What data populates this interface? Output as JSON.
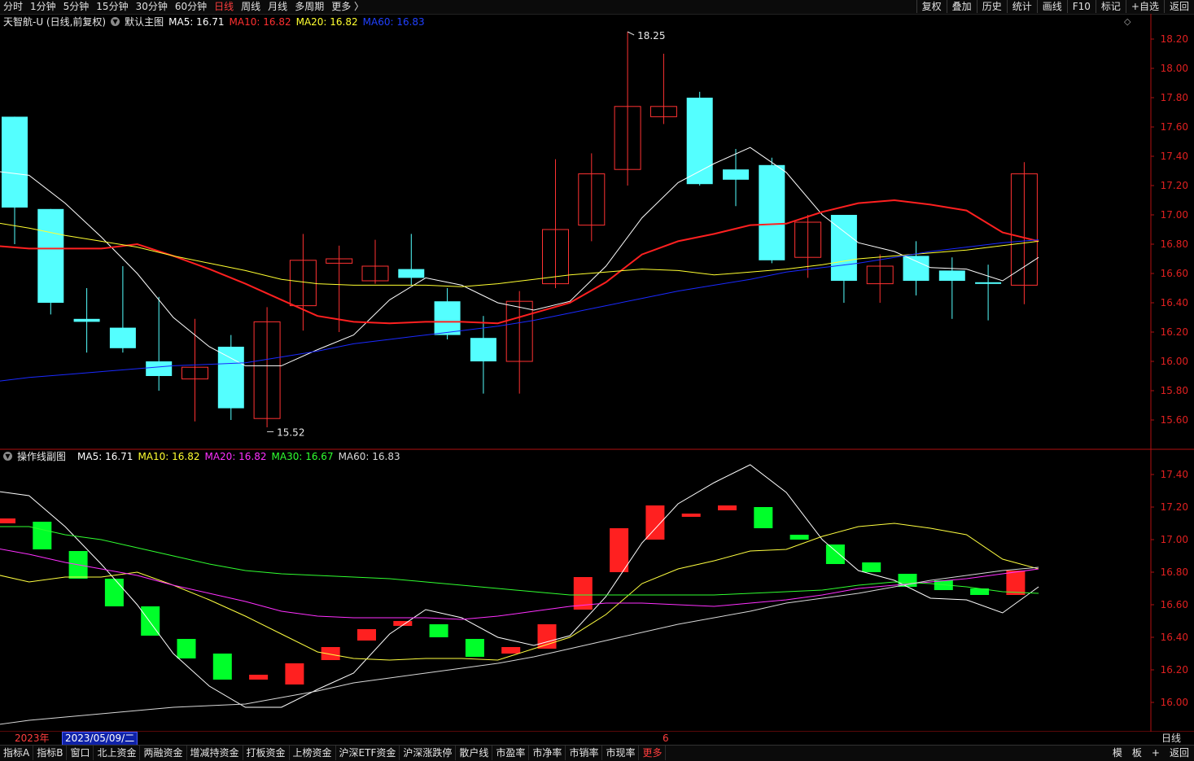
{
  "toolbar": {
    "periods": [
      "分时",
      "1分钟",
      "5分钟",
      "15分钟",
      "30分钟",
      "60分钟",
      "日线",
      "周线",
      "月线",
      "多周期",
      "更多 〉"
    ],
    "active_period": "日线",
    "right_items": [
      "复权",
      "叠加",
      "历史",
      "统计",
      "画线",
      "F10",
      "标记",
      "+自选",
      "返回"
    ]
  },
  "main_legend": {
    "title": "天智航-U (日线,前复权)",
    "template": "默认主图",
    "ma5": "MA5: 16.71",
    "ma10": "MA10: 16.82",
    "ma20": "MA20: 16.82",
    "ma60": "MA60: 16.83"
  },
  "sub_legend": {
    "title": "操作线副图",
    "ma5": "MA5: 16.71",
    "ma10": "MA10: 16.82",
    "ma20": "MA20: 16.82",
    "ma30": "MA30: 16.67",
    "ma60": "MA60: 16.83"
  },
  "colors": {
    "up": "#ff3232",
    "down": "#54ffff",
    "sub_up": "#ff2020",
    "sub_down": "#00ff2a",
    "ma5": "#ffffff",
    "ma10": "#ff2020",
    "ma20": "#ffff30",
    "ma60": "#1a2aff",
    "sub_ma10": "#ffff40",
    "sub_ma20": "#ff30ff",
    "sub_ma30": "#30ff30",
    "sub_ma60": "#d8d8d8"
  },
  "date_bar": {
    "year": "2023年",
    "cursor_date": "2023/05/09/二",
    "month_mark": "6"
  },
  "period_label": "日线",
  "bottom_bar": {
    "tabs": [
      "指标A",
      "指标B",
      "窗口",
      "北上资金",
      "两融资金",
      "增减持资金",
      "打板资金",
      "上榜资金",
      "沪深ETF资金",
      "沪深涨跌停",
      "散户线",
      "市盈率",
      "市净率",
      "市销率",
      "市现率",
      "更多"
    ],
    "right": [
      "模",
      "板",
      "+",
      "返回"
    ]
  },
  "chart_data": [
    {
      "type": "candlestick",
      "name": "main",
      "ylim": [
        15.45,
        18.3
      ],
      "yticks": [
        15.6,
        15.8,
        16.0,
        16.2,
        16.4,
        16.6,
        16.8,
        17.0,
        17.2,
        17.4,
        17.6,
        17.8,
        18.0,
        18.2
      ],
      "annotations": [
        {
          "text": "18.25",
          "candle": 17,
          "value": 18.25
        },
        {
          "text": "15.52",
          "candle": 7,
          "value": 15.52
        }
      ],
      "candles": [
        {
          "o": 17.67,
          "c": 17.05,
          "h": 17.67,
          "l": 16.8
        },
        {
          "o": 17.04,
          "c": 16.4,
          "h": 17.04,
          "l": 16.32
        },
        {
          "o": 16.29,
          "c": 16.27,
          "h": 16.5,
          "l": 16.06
        },
        {
          "o": 16.23,
          "c": 16.09,
          "h": 16.65,
          "l": 16.06
        },
        {
          "o": 16.0,
          "c": 15.9,
          "h": 16.44,
          "l": 15.8
        },
        {
          "o": 15.88,
          "c": 15.96,
          "h": 16.29,
          "l": 15.59
        },
        {
          "o": 16.1,
          "c": 15.68,
          "h": 16.18,
          "l": 15.6
        },
        {
          "o": 15.61,
          "c": 16.27,
          "h": 16.37,
          "l": 15.55
        },
        {
          "o": 16.38,
          "c": 16.69,
          "h": 16.87,
          "l": 16.21
        },
        {
          "o": 16.67,
          "c": 16.7,
          "h": 16.79,
          "l": 16.2
        },
        {
          "o": 16.55,
          "c": 16.65,
          "h": 16.83,
          "l": 16.53
        },
        {
          "o": 16.63,
          "c": 16.57,
          "h": 16.87,
          "l": 16.52
        },
        {
          "o": 16.41,
          "c": 16.18,
          "h": 16.5,
          "l": 16.15
        },
        {
          "o": 16.16,
          "c": 16.0,
          "h": 16.31,
          "l": 15.78
        },
        {
          "o": 16.0,
          "c": 16.41,
          "h": 16.48,
          "l": 15.78
        },
        {
          "o": 16.53,
          "c": 16.9,
          "h": 17.38,
          "l": 16.5
        },
        {
          "o": 16.93,
          "c": 17.28,
          "h": 17.42,
          "l": 16.82
        },
        {
          "o": 17.31,
          "c": 17.74,
          "h": 18.25,
          "l": 17.2
        },
        {
          "o": 17.67,
          "c": 17.74,
          "h": 18.1,
          "l": 17.62
        },
        {
          "o": 17.8,
          "c": 17.21,
          "h": 17.84,
          "l": 17.2
        },
        {
          "o": 17.31,
          "c": 17.24,
          "h": 17.45,
          "l": 17.06
        },
        {
          "o": 17.34,
          "c": 16.69,
          "h": 17.39,
          "l": 16.67
        },
        {
          "o": 16.71,
          "c": 16.95,
          "h": 17.0,
          "l": 16.57
        },
        {
          "o": 17.0,
          "c": 16.55,
          "h": 17.0,
          "l": 16.4
        },
        {
          "o": 16.53,
          "c": 16.65,
          "h": 16.73,
          "l": 16.4
        },
        {
          "o": 16.72,
          "c": 16.55,
          "h": 16.82,
          "l": 16.45
        },
        {
          "o": 16.62,
          "c": 16.55,
          "h": 16.71,
          "l": 16.29
        },
        {
          "o": 16.54,
          "c": 16.53,
          "h": 16.66,
          "l": 16.28
        },
        {
          "o": 16.52,
          "c": 17.28,
          "h": 17.36,
          "l": 16.39
        }
      ],
      "series": [
        {
          "name": "MA5",
          "values": [
            17.3,
            17.27,
            17.08,
            16.85,
            16.6,
            16.3,
            16.1,
            15.97,
            15.97,
            16.08,
            16.18,
            16.42,
            16.57,
            16.52,
            16.4,
            16.35,
            16.41,
            16.65,
            16.98,
            17.22,
            17.35,
            17.46,
            17.29,
            17.0,
            16.81,
            16.75,
            16.64,
            16.63,
            16.55,
            16.71
          ]
        },
        {
          "name": "MA10",
          "values": [
            16.79,
            16.77,
            16.77,
            16.77,
            16.8,
            16.72,
            16.63,
            16.53,
            16.42,
            16.31,
            16.27,
            16.26,
            16.27,
            16.27,
            16.26,
            16.33,
            16.4,
            16.54,
            16.73,
            16.82,
            16.87,
            16.93,
            16.94,
            17.02,
            17.08,
            17.1,
            17.07,
            17.03,
            16.88,
            16.82
          ]
        },
        {
          "name": "MA20",
          "values": [
            16.95,
            16.91,
            16.86,
            16.82,
            16.78,
            16.72,
            16.67,
            16.62,
            16.56,
            16.53,
            16.52,
            16.52,
            16.52,
            16.51,
            16.53,
            16.56,
            16.59,
            16.61,
            16.63,
            16.62,
            16.59,
            16.61,
            16.63,
            16.66,
            16.7,
            16.72,
            16.74,
            16.76,
            16.79,
            16.82
          ]
        },
        {
          "name": "MA60",
          "values": [
            15.86,
            15.89,
            15.91,
            15.93,
            15.95,
            15.97,
            15.98,
            15.99,
            16.03,
            16.07,
            16.12,
            16.15,
            16.18,
            16.21,
            16.24,
            16.28,
            16.33,
            16.38,
            16.43,
            16.48,
            16.52,
            16.56,
            16.61,
            16.64,
            16.67,
            16.71,
            16.75,
            16.78,
            16.81,
            16.83
          ]
        }
      ]
    },
    {
      "type": "bar",
      "name": "sub",
      "ylim": [
        15.85,
        17.5
      ],
      "yticks": [
        16.0,
        16.2,
        16.4,
        16.6,
        16.8,
        17.0,
        17.2,
        17.4
      ],
      "boxes": [
        {
          "o": 17.1,
          "c": 17.13
        },
        {
          "o": 17.11,
          "c": 16.94
        },
        {
          "o": 16.93,
          "c": 16.76
        },
        {
          "o": 16.76,
          "c": 16.59
        },
        {
          "o": 16.59,
          "c": 16.41
        },
        {
          "o": 16.39,
          "c": 16.27
        },
        {
          "o": 16.3,
          "c": 16.14
        },
        {
          "o": 16.14,
          "c": 16.17
        },
        {
          "o": 16.11,
          "c": 16.24
        },
        {
          "o": 16.26,
          "c": 16.34
        },
        {
          "o": 16.38,
          "c": 16.45
        },
        {
          "o": 16.47,
          "c": 16.5
        },
        {
          "o": 16.48,
          "c": 16.4
        },
        {
          "o": 16.39,
          "c": 16.28
        },
        {
          "o": 16.3,
          "c": 16.34
        },
        {
          "o": 16.33,
          "c": 16.48
        },
        {
          "o": 16.57,
          "c": 16.77
        },
        {
          "o": 16.8,
          "c": 17.07
        },
        {
          "o": 17.0,
          "c": 17.21
        },
        {
          "o": 17.14,
          "c": 17.16
        },
        {
          "o": 17.18,
          "c": 17.21
        },
        {
          "o": 17.2,
          "c": 17.07
        },
        {
          "o": 17.03,
          "c": 17.0
        },
        {
          "o": 16.97,
          "c": 16.85
        },
        {
          "o": 16.86,
          "c": 16.8
        },
        {
          "o": 16.79,
          "c": 16.71
        },
        {
          "o": 16.75,
          "c": 16.69
        },
        {
          "o": 16.7,
          "c": 16.66
        },
        {
          "o": 16.66,
          "c": 16.81
        }
      ],
      "series": [
        {
          "name": "MA5",
          "values": [
            17.3,
            17.27,
            17.08,
            16.85,
            16.6,
            16.3,
            16.1,
            15.97,
            15.97,
            16.08,
            16.18,
            16.42,
            16.57,
            16.52,
            16.4,
            16.35,
            16.41,
            16.65,
            16.98,
            17.22,
            17.35,
            17.46,
            17.29,
            17.0,
            16.81,
            16.75,
            16.64,
            16.63,
            16.55,
            16.71
          ]
        },
        {
          "name": "MA10",
          "values": [
            16.79,
            16.74,
            16.77,
            16.77,
            16.8,
            16.72,
            16.63,
            16.53,
            16.42,
            16.31,
            16.27,
            16.26,
            16.27,
            16.27,
            16.26,
            16.33,
            16.4,
            16.54,
            16.73,
            16.82,
            16.87,
            16.93,
            16.94,
            17.02,
            17.08,
            17.1,
            17.07,
            17.03,
            16.88,
            16.82
          ]
        },
        {
          "name": "MA20",
          "values": [
            16.95,
            16.91,
            16.86,
            16.82,
            16.78,
            16.72,
            16.67,
            16.62,
            16.56,
            16.53,
            16.52,
            16.52,
            16.52,
            16.51,
            16.53,
            16.56,
            16.59,
            16.61,
            16.61,
            16.6,
            16.59,
            16.61,
            16.63,
            16.66,
            16.7,
            16.72,
            16.74,
            16.76,
            16.79,
            16.82
          ]
        },
        {
          "name": "MA30",
          "values": [
            17.08,
            17.08,
            17.03,
            17.0,
            16.95,
            16.9,
            16.85,
            16.81,
            16.79,
            16.78,
            16.77,
            16.76,
            16.74,
            16.72,
            16.7,
            16.68,
            16.66,
            16.66,
            16.66,
            16.66,
            16.66,
            16.67,
            16.68,
            16.69,
            16.72,
            16.74,
            16.73,
            16.71,
            16.68,
            16.67
          ]
        },
        {
          "name": "MA60",
          "values": [
            15.86,
            15.89,
            15.91,
            15.93,
            15.95,
            15.97,
            15.98,
            15.99,
            16.03,
            16.07,
            16.12,
            16.15,
            16.18,
            16.21,
            16.24,
            16.28,
            16.33,
            16.38,
            16.43,
            16.48,
            16.52,
            16.56,
            16.61,
            16.64,
            16.67,
            16.71,
            16.75,
            16.78,
            16.81,
            16.83
          ]
        }
      ]
    }
  ]
}
